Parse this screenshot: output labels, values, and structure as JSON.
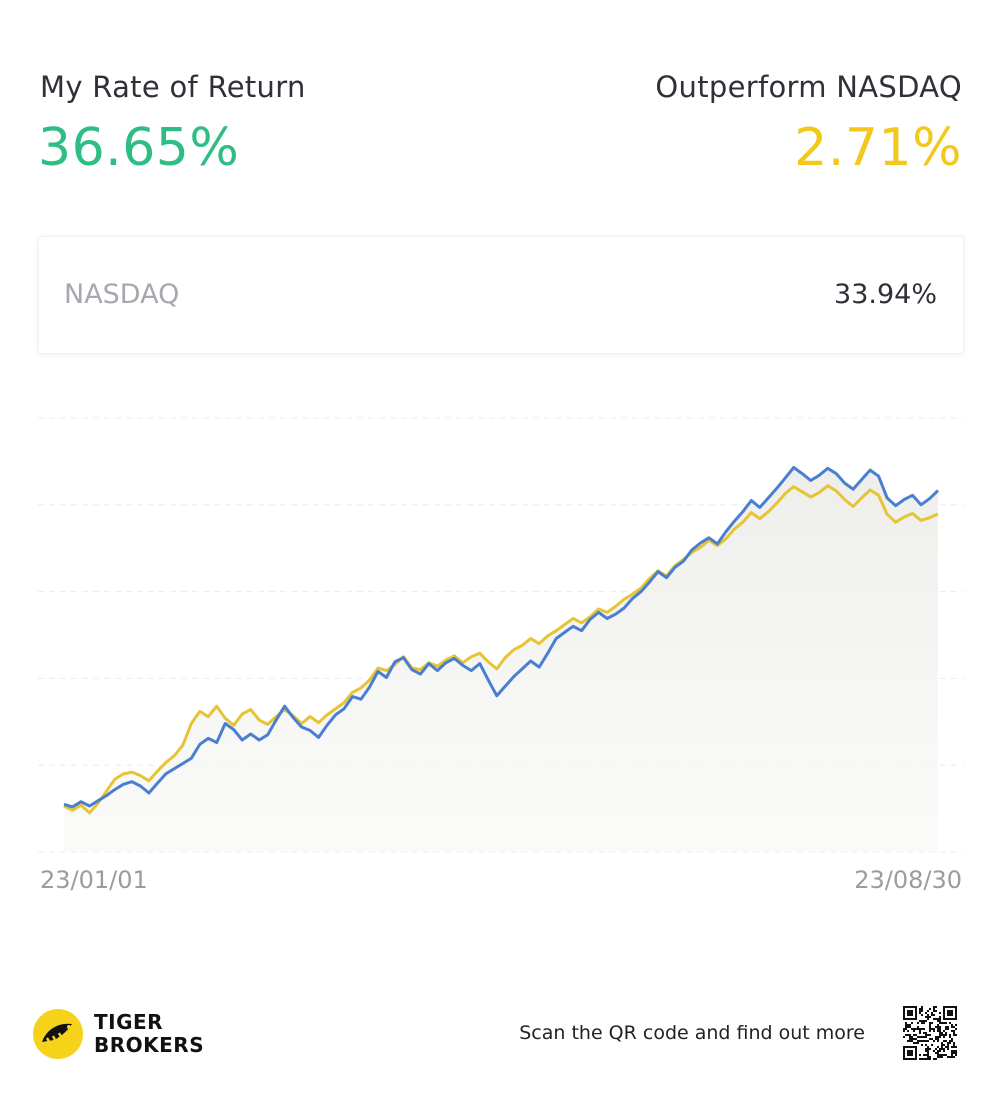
{
  "summary": {
    "my_return_label": "My Rate of Return",
    "my_return_value": "36.65%",
    "outperform_label": "Outperform NASDAQ",
    "outperform_value": "2.71%"
  },
  "benchmark": {
    "name": "NASDAQ",
    "value": "33.94%"
  },
  "colors": {
    "positive_green": "#2dbd85",
    "accent_yellow": "#f2c81d",
    "my_line_blue": "#4a7fd0",
    "nasdaq_line_yellow": "#e7c434"
  },
  "chart_data": {
    "type": "line",
    "x_start_label": "23/01/01",
    "x_end_label": "23/08/30",
    "grid": true,
    "ylim": [
      -5,
      45
    ],
    "series": [
      {
        "name": "My Rate of Return",
        "color": "#4a7fd0",
        "values": [
          0.5,
          0.2,
          0.8,
          0.3,
          0.9,
          1.5,
          2.2,
          2.8,
          3.1,
          2.6,
          1.8,
          2.9,
          4.0,
          4.6,
          5.2,
          5.8,
          7.4,
          8.1,
          7.6,
          9.8,
          9.1,
          7.9,
          8.6,
          7.9,
          8.5,
          10.2,
          11.8,
          10.5,
          9.4,
          9.0,
          8.2,
          9.6,
          10.8,
          11.5,
          12.9,
          12.6,
          14.0,
          15.8,
          15.1,
          16.9,
          17.4,
          16.0,
          15.5,
          16.7,
          15.9,
          16.8,
          17.3,
          16.5,
          15.9,
          16.7,
          14.8,
          13.0,
          14.1,
          15.2,
          16.1,
          17.0,
          16.3,
          17.9,
          19.6,
          20.3,
          21.0,
          20.5,
          21.8,
          22.6,
          21.9,
          22.4,
          23.1,
          24.2,
          25.0,
          26.1,
          27.3,
          26.6,
          27.8,
          28.5,
          29.8,
          30.6,
          31.2,
          30.5,
          31.9,
          33.1,
          34.2,
          35.5,
          34.7,
          35.8,
          36.9,
          38.1,
          39.3,
          38.6,
          37.8,
          38.4,
          39.2,
          38.6,
          37.5,
          36.8,
          37.9,
          39.0,
          38.3,
          35.8,
          34.9,
          35.6,
          36.1,
          35.0,
          35.7,
          36.65
        ]
      },
      {
        "name": "NASDAQ",
        "color": "#e7c434",
        "values": [
          0.3,
          -0.2,
          0.4,
          -0.5,
          0.6,
          2.0,
          3.4,
          4.0,
          4.2,
          3.8,
          3.2,
          4.3,
          5.3,
          6.1,
          7.3,
          9.8,
          11.2,
          10.6,
          11.8,
          10.4,
          9.6,
          10.9,
          11.4,
          10.2,
          9.7,
          10.6,
          11.4,
          10.7,
          9.8,
          10.6,
          9.9,
          10.8,
          11.5,
          12.2,
          13.4,
          13.9,
          14.8,
          16.2,
          15.9,
          16.6,
          17.5,
          16.2,
          16.0,
          16.8,
          16.4,
          17.1,
          17.6,
          16.8,
          17.5,
          17.9,
          16.9,
          16.1,
          17.4,
          18.3,
          18.8,
          19.6,
          19.0,
          19.9,
          20.5,
          21.2,
          21.9,
          21.4,
          22.1,
          23.0,
          22.6,
          23.3,
          24.1,
          24.7,
          25.4,
          26.5,
          27.4,
          26.8,
          28.0,
          28.7,
          29.5,
          30.1,
          30.9,
          30.3,
          31.1,
          32.2,
          33.0,
          34.1,
          33.4,
          34.2,
          35.2,
          36.3,
          37.1,
          36.5,
          35.9,
          36.4,
          37.2,
          36.6,
          35.6,
          34.8,
          35.8,
          36.7,
          36.1,
          33.9,
          33.0,
          33.6,
          34.0,
          33.2,
          33.5,
          33.94
        ]
      }
    ]
  },
  "footer": {
    "brand_line1": "TIGER",
    "brand_line2": "BROKERS",
    "scan_text": "Scan the QR code and find out more",
    "logo_icon": "tiger-logo-icon",
    "qr_icon": "qr-code-icon"
  }
}
